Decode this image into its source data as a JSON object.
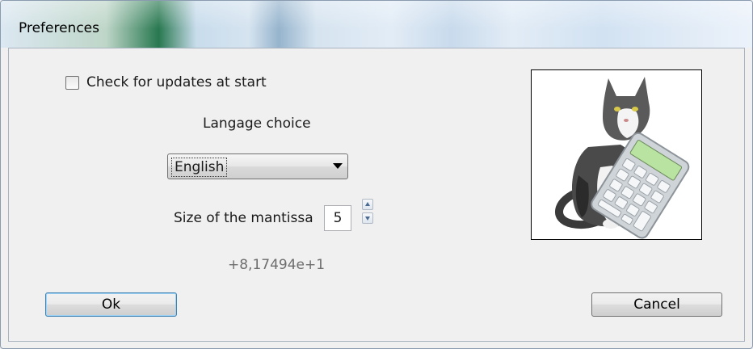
{
  "window": {
    "title": "Preferences"
  },
  "options": {
    "check_updates_label": "Check for updates at start",
    "check_updates_checked": false
  },
  "language": {
    "label": "Langage choice",
    "selected": "English"
  },
  "mantissa": {
    "label": "Size of the mantissa",
    "value": "5"
  },
  "preview": {
    "value": "+8,17494e+1"
  },
  "buttons": {
    "ok_label": "Ok",
    "cancel_label": "Cancel"
  },
  "image": {
    "subject": "cat-with-calculator"
  },
  "colors": {
    "ok_focus": "#3c7fb1",
    "preview_text": "#6d6d6d"
  }
}
